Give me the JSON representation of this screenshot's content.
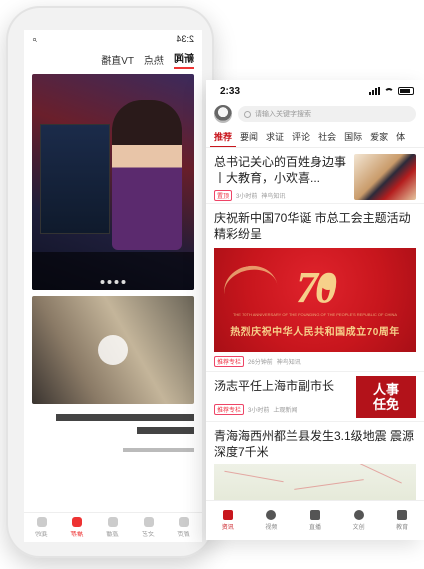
{
  "front": {
    "status": {
      "time": "2:33"
    },
    "search": {
      "placeholder": "请输入关键字搜索"
    },
    "tabs": [
      "推荐",
      "要闻",
      "求证",
      "评论",
      "社会",
      "国际",
      "爱家",
      "体"
    ],
    "news": [
      {
        "title": "总书记关心的百姓身边事丨大教育，小欢喜...",
        "tag": "置顶",
        "time": "3小时前",
        "source": "神鸟知讯"
      },
      {
        "title": "庆祝新中国70华诞 市总工会主题活动精彩纷呈",
        "banner_number": "70",
        "banner_slogan": "热烈庆祝中华人民共和国成立70周年",
        "banner_sub": "THE 70TH ANNIVERSARY OF THE FOUNDING OF THE PEOPLE'S REPUBLIC OF CHINA",
        "tag": "推荐专栏",
        "time": "26分钟前",
        "source": "神鸟知讯"
      },
      {
        "title": "汤志平任上海市副市长",
        "thumb_line1": "人事",
        "thumb_line2": "任免",
        "tag": "推荐专栏",
        "time": "3小时前",
        "source": "上观新闻"
      },
      {
        "title": "青海海西州都兰县发生3.1级地震 震源深度7千米"
      }
    ],
    "bottom_nav": [
      {
        "label": "资讯",
        "icon": "news-icon"
      },
      {
        "label": "视频",
        "icon": "video-icon"
      },
      {
        "label": "直播",
        "icon": "live-icon"
      },
      {
        "label": "文创",
        "icon": "creative-icon"
      },
      {
        "label": "教育",
        "icon": "education-icon"
      }
    ]
  },
  "back": {
    "time": "2:34",
    "tabs": [
      "新闻",
      "热点",
      "TV直播"
    ],
    "nav": [
      "首页",
      "文艺",
      "直播",
      "推荐",
      "我的"
    ]
  }
}
